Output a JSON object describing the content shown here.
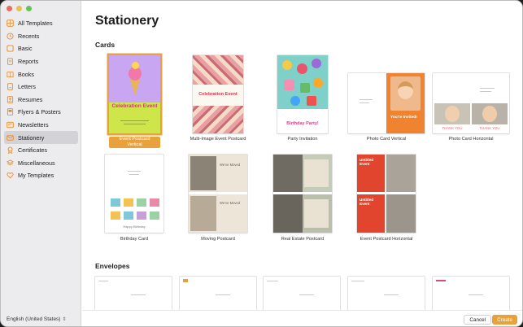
{
  "sidebar": {
    "items": [
      {
        "label": "All Templates",
        "icon": "grid-icon"
      },
      {
        "label": "Recents",
        "icon": "clock-icon"
      },
      {
        "label": "Basic",
        "icon": "square-icon"
      },
      {
        "label": "Reports",
        "icon": "doc-icon"
      },
      {
        "label": "Books",
        "icon": "book-icon"
      },
      {
        "label": "Letters",
        "icon": "letter-icon"
      },
      {
        "label": "Resumes",
        "icon": "person-icon"
      },
      {
        "label": "Flyers & Posters",
        "icon": "flyer-icon"
      },
      {
        "label": "Newsletters",
        "icon": "newspaper-icon"
      },
      {
        "label": "Stationery",
        "icon": "envelope-icon"
      },
      {
        "label": "Certificates",
        "icon": "ribbon-icon"
      },
      {
        "label": "Miscellaneous",
        "icon": "layers-icon"
      },
      {
        "label": "My Templates",
        "icon": "heart-icon"
      }
    ],
    "selected_index": 9,
    "language": "English (United States)",
    "accent_color": "#e88a23"
  },
  "main": {
    "title": "Stationery",
    "cards_heading": "Cards",
    "envelopes_heading": "Envelopes",
    "cards": [
      {
        "caption": "Event Postcard Vertical",
        "selected": true
      },
      {
        "caption": "Multi-Image Event Postcard",
        "selected": false
      },
      {
        "caption": "Party Invitation",
        "selected": false
      },
      {
        "caption": "Photo Card Vertical",
        "selected": false
      },
      {
        "caption": "Photo Card Horizontal",
        "selected": false
      },
      {
        "caption": "Birthday Card",
        "selected": false
      },
      {
        "caption": "Moving Postcard",
        "selected": false
      },
      {
        "caption": "Real Estate Postcard",
        "selected": false
      },
      {
        "caption": "Event Postcard Horizontal",
        "selected": false
      }
    ],
    "thumb_text": {
      "celebration_event": "Celebration Event",
      "birthday_party": "Birthday Party!",
      "youre_invited": "You're Invited!",
      "thank_you": "THANK YOU",
      "were_moved": "We've Moved",
      "untitled_event": "Untitled Event",
      "happy_birthday": "Happy Birthday"
    }
  },
  "footer": {
    "cancel_label": "Cancel",
    "create_label": "Create",
    "create_color": "#e9a23b"
  }
}
